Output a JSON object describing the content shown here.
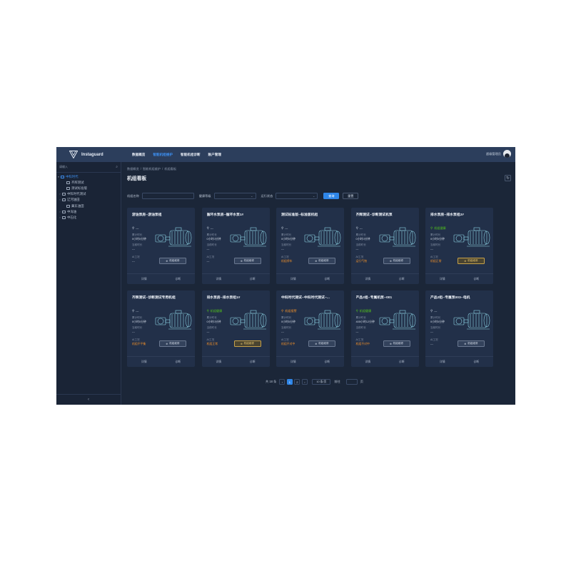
{
  "app": {
    "name": "Instaguard"
  },
  "nav": [
    "数据概览",
    "智能机组维护",
    "智能机组诊断",
    "账户管理"
  ],
  "user": {
    "name": "超级管理员"
  },
  "sidebar": {
    "search_placeholder": "请输入",
    "tree": [
      {
        "label": "中科时代",
        "arrow": "▾",
        "active": true
      },
      {
        "label": "齐辉测试",
        "arrow": "",
        "active": false
      },
      {
        "label": "测试标准版",
        "arrow": "",
        "active": false
      },
      {
        "label": "中科时代测试",
        "arrow": "›",
        "active": false
      },
      {
        "label": "辽河油田",
        "arrow": "›",
        "active": false
      },
      {
        "label": "冀东油田",
        "arrow": "",
        "active": false
      },
      {
        "label": "中海油",
        "arrow": "›",
        "active": false
      },
      {
        "label": "中石化",
        "arrow": "›",
        "active": false
      }
    ],
    "collapse": "‹"
  },
  "breadcrumb": [
    "数据概览",
    "智能机组维护",
    "机组看板"
  ],
  "page_title": "机组看板",
  "filters": {
    "name_label": "机组名称",
    "health_label": "健康等级",
    "run_label": "运行状态",
    "search": "查询",
    "reset": "重置"
  },
  "colors": {
    "healthy": "#52c41a",
    "warning": "#f0902a",
    "unknown": "#c8d2e0"
  },
  "cards": [
    {
      "title": "游油泵房--游油泵组",
      "status": "---",
      "status_color": "#c8d2e0",
      "runtime_label": "累计时长",
      "runtime": "0小时0分钟",
      "current_label": "当前时长",
      "current": "---",
      "ai_label": "AI工况",
      "ai": "---",
      "ai_color": "#d2dae6",
      "repair": "机组维修",
      "repair_warn": false
    },
    {
      "title": "循环水泵房--循环水泵1#",
      "status": "---",
      "status_color": "#c8d2e0",
      "runtime_label": "累计时长",
      "runtime": "0小时0分钟",
      "current_label": "当前时长",
      "current": "---",
      "ai_label": "AI工况",
      "ai": "---",
      "ai_color": "#d2dae6",
      "repair": "机组维修",
      "repair_warn": false
    },
    {
      "title": "测试标准版--标准版机组",
      "status": "---",
      "status_color": "#c8d2e0",
      "runtime_label": "累计时长",
      "runtime": "0小时0分钟",
      "current_label": "当前时长",
      "current": "---",
      "ai_label": "AI工况",
      "ai": "机组停车",
      "ai_color": "#f0902a",
      "repair": "机组维修",
      "repair_warn": false
    },
    {
      "title": "齐辉测试--诊断测试机泵",
      "status": "---",
      "status_color": "#c8d2e0",
      "runtime_label": "累计时长",
      "runtime": "0小时0分钟",
      "current_label": "当前时长",
      "current": "---",
      "ai_label": "AI工况",
      "ai": "运行气蚀",
      "ai_color": "#f0902a",
      "repair": "机组维修",
      "repair_warn": false
    },
    {
      "title": "排水泵房--排水泵组2#",
      "status": "机组健康",
      "status_color": "#52c41a",
      "runtime_label": "累计时长",
      "runtime": "0小时0分钟",
      "current_label": "当前时长",
      "current": "---",
      "ai_label": "AI工况",
      "ai": "机组正常",
      "ai_color": "#f0902a",
      "repair": "机组维修",
      "repair_warn": true
    },
    {
      "title": "齐辉测试--诊断测试专用机组",
      "status": "---",
      "status_color": "#c8d2e0",
      "runtime_label": "累计时长",
      "runtime": "0小时0分钟",
      "current_label": "当前时长",
      "current": "---",
      "ai_label": "AI工况",
      "ai": "机组不平衡",
      "ai_color": "#f0902a",
      "repair": "机组维修",
      "repair_warn": false
    },
    {
      "title": "排水泵房--排水泵组1#",
      "status": "机组健康",
      "status_color": "#52c41a",
      "runtime_label": "累计时长",
      "runtime": "0小时0分钟",
      "current_label": "当前时长",
      "current": "---",
      "ai_label": "AI工况",
      "ai": "机组正常",
      "ai_color": "#f0902a",
      "repair": "机组维修",
      "repair_warn": true
    },
    {
      "title": "中科时代测试--中科时代测试--...",
      "status": "机组报警",
      "status_color": "#f0902a",
      "runtime_label": "累计时长",
      "runtime": "0小时0分钟",
      "current_label": "当前时长",
      "current": "---",
      "ai_label": "AI工况",
      "ai": "机组不对中",
      "ai_color": "#f0902a",
      "repair": "机组维修",
      "repair_warn": false
    },
    {
      "title": "产品2组--专属机泵--001",
      "status": "机组健康",
      "status_color": "#52c41a",
      "runtime_label": "累计时长",
      "runtime": "405小时12分钟",
      "current_label": "当前时长",
      "current": "---",
      "ai_label": "AI工况",
      "ai": "机组不对中",
      "ai_color": "#f0902a",
      "repair": "机组维修",
      "repair_warn": false
    },
    {
      "title": "产品2组--专属泵003--电机",
      "status": "---",
      "status_color": "#c8d2e0",
      "runtime_label": "累计时长",
      "runtime": "0小时0分钟",
      "current_label": "当前时长",
      "current": "---",
      "ai_label": "AI工况",
      "ai": "---",
      "ai_color": "#d2dae6",
      "repair": "机组维修",
      "repair_warn": false
    }
  ],
  "card_actions": [
    "详情",
    "诊断"
  ],
  "pagination": {
    "total": "共 18 条",
    "prev": "‹",
    "pages": [
      "1",
      "2"
    ],
    "current": "1",
    "next": "›",
    "page_size": "10 条/页",
    "goto_label": "前往",
    "goto_suffix": "页"
  }
}
